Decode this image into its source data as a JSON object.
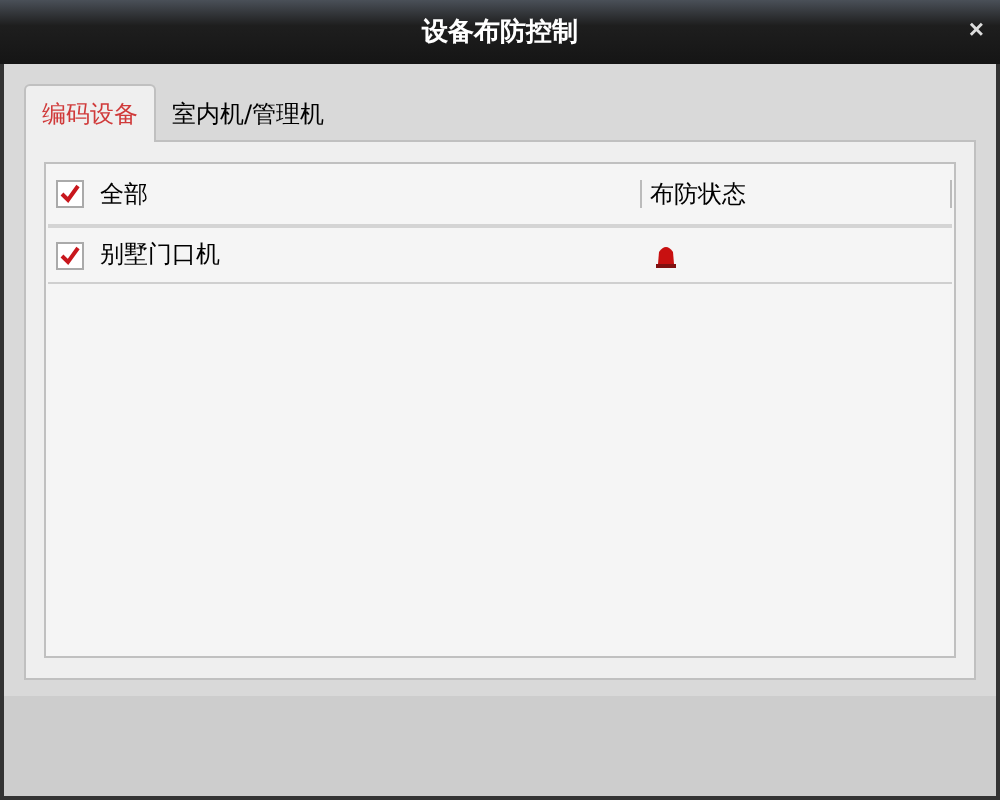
{
  "window": {
    "title": "设备布防控制",
    "close": "×"
  },
  "tabs": [
    {
      "label": "编码设备",
      "selected": true
    },
    {
      "label": "室内机/管理机",
      "selected": false
    }
  ],
  "table": {
    "select_all": {
      "label": "全部",
      "checked": true
    },
    "columns": [
      "布防状态"
    ],
    "rows": [
      {
        "name": "别墅门口机",
        "checked": true,
        "armed": true
      }
    ]
  }
}
